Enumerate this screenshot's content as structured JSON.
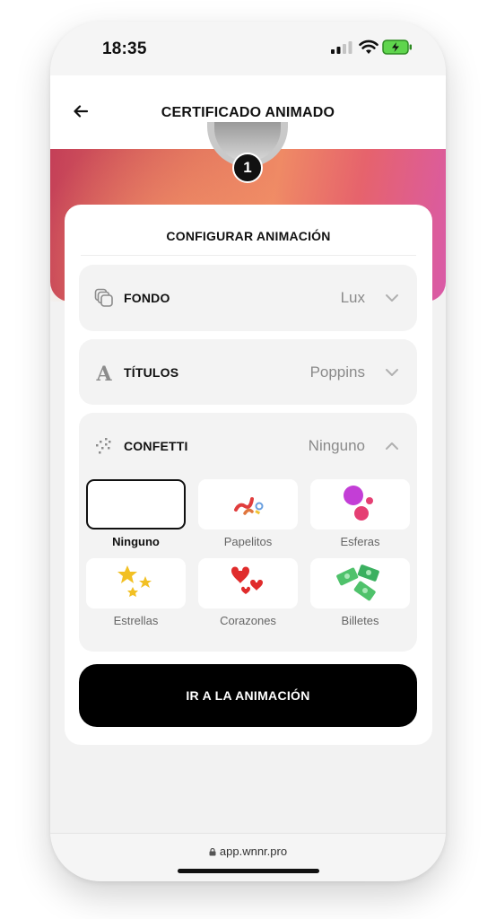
{
  "status_bar": {
    "time": "18:35",
    "icons": [
      "cellular-signal-icon",
      "wifi-icon",
      "battery-charging-icon"
    ]
  },
  "header": {
    "title": "CERTIFICADO ANIMADO",
    "back_icon": "arrow-left-icon"
  },
  "hero": {
    "step_number": "1",
    "gradient_colors": [
      "#c43f58",
      "#ef8a65",
      "#d95aa8"
    ]
  },
  "config": {
    "title": "CONFIGURAR ANIMACIÓN",
    "rows": [
      {
        "icon": "layers-icon",
        "label": "FONDO",
        "value": "Lux",
        "expanded": false
      },
      {
        "icon": "font-letter-icon",
        "label": "TÍTULOS",
        "value": "Poppins",
        "expanded": false
      },
      {
        "icon": "confetti-icon",
        "label": "CONFETTI",
        "value": "Ninguno",
        "expanded": true
      }
    ],
    "confetti_options": [
      {
        "label": "Ninguno",
        "icon": "none",
        "selected": true
      },
      {
        "label": "Papelitos",
        "icon": "paper-confetti-icon",
        "selected": false
      },
      {
        "label": "Esferas",
        "icon": "spheres-icon",
        "selected": false
      },
      {
        "label": "Estrellas",
        "icon": "stars-icon",
        "selected": false
      },
      {
        "label": "Corazones",
        "icon": "hearts-icon",
        "selected": false
      },
      {
        "label": "Billetes",
        "icon": "banknotes-icon",
        "selected": false
      }
    ]
  },
  "cta_label": "IR A LA ANIMACIÓN",
  "browser": {
    "url": "app.wnnr.pro"
  },
  "colors": {
    "primary": "#000000",
    "card": "#ffffff",
    "row_bg": "#f3f3f3",
    "muted_text": "#8a8a8a"
  }
}
